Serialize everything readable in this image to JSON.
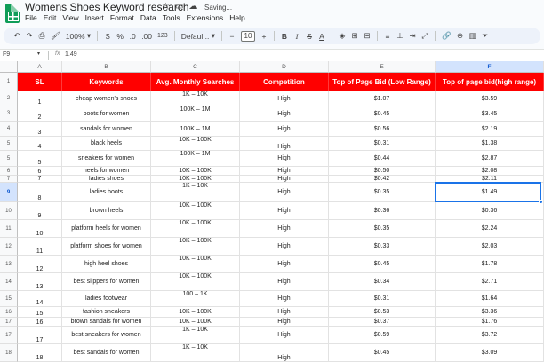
{
  "doc": {
    "title": "Womens Shoes Keyword research",
    "saving": "Saving...",
    "star_icon": "star-icon",
    "move_icon": "folder-icon",
    "cloud_icon": "cloud-sync-icon"
  },
  "menu": [
    "File",
    "Edit",
    "View",
    "Insert",
    "Format",
    "Data",
    "Tools",
    "Extensions",
    "Help"
  ],
  "toolbar": {
    "zoom": "100%",
    "currency": "$",
    "percent": "%",
    "dec_decrease": ".0",
    "dec_increase": ".00",
    "number_format": "123",
    "font": "Defaul...",
    "font_size": "10",
    "minus": "−",
    "plus": "+"
  },
  "formula_bar": {
    "name_box": "F9",
    "fx": "fx",
    "value": "1.49"
  },
  "columns": [
    "A",
    "B",
    "C",
    "D",
    "E",
    "F"
  ],
  "selected_column": "F",
  "selected_row": "9",
  "header_row": {
    "row_number": "1",
    "cells": [
      "SL",
      "Keywords",
      "Avg. Monthly Searches",
      "Competition",
      "Top of Page Bid (Low Range)",
      "Top of page bid(high range)"
    ]
  },
  "rows": [
    {
      "n": "2",
      "sl": "1",
      "kw": "cheap women's shoes",
      "avg": "1K – 10K",
      "comp": "High",
      "low": "$1.07",
      "high": "$3.59"
    },
    {
      "n": "3",
      "sl": "2",
      "kw": "boots for women",
      "avg": "100K – 1M",
      "comp": "High",
      "low": "$0.45",
      "high": "$3.45"
    },
    {
      "n": "4",
      "sl": "3",
      "kw": "sandals for women",
      "avg": "100K – 1M",
      "comp": "High",
      "low": "$0.56",
      "high": "$2.19"
    },
    {
      "n": "5",
      "sl": "4",
      "kw": "black heels",
      "avg": "10K – 100K",
      "comp": "High",
      "low": "$0.31",
      "high": "$1.38"
    },
    {
      "n": "5",
      "sl": "5",
      "kw": "sneakers for women",
      "avg": "100K – 1M",
      "comp": "High",
      "low": "$0.44",
      "high": "$2.87"
    },
    {
      "n": "6",
      "sl": "6",
      "kw": "heels for women",
      "avg": "10K – 100K",
      "comp": "High",
      "low": "$0.50",
      "high": "$2.08"
    },
    {
      "n": "7",
      "sl": "7",
      "kw": "ladies shoes",
      "avg": "10K – 100K",
      "comp": "High",
      "low": "$0.42",
      "high": "$2.11"
    },
    {
      "n": "9",
      "sl": "8",
      "kw": "ladies boots",
      "avg": "1K – 10K",
      "comp": "High",
      "low": "$0.35",
      "high": "$1.49"
    },
    {
      "n": "10",
      "sl": "9",
      "kw": "brown heels",
      "avg": "10K – 100K",
      "comp": "High",
      "low": "$0.36",
      "high": "$0.36"
    },
    {
      "n": "11",
      "sl": "10",
      "kw": "platform heels for women",
      "avg": "10K – 100K",
      "comp": "High",
      "low": "$0.35",
      "high": "$2.24"
    },
    {
      "n": "12",
      "sl": "11",
      "kw": "platform shoes for women",
      "avg": "10K – 100K",
      "comp": "High",
      "low": "$0.33",
      "high": "$2.03"
    },
    {
      "n": "13",
      "sl": "12",
      "kw": "high heel shoes",
      "avg": "10K – 100K",
      "comp": "High",
      "low": "$0.45",
      "high": "$1.78"
    },
    {
      "n": "14",
      "sl": "13",
      "kw": "best slippers for women",
      "avg": "10K – 100K",
      "comp": "High",
      "low": "$0.34",
      "high": "$2.71"
    },
    {
      "n": "15",
      "sl": "14",
      "kw": "ladies footwear",
      "avg": "100 – 1K",
      "comp": "High",
      "low": "$0.31",
      "high": "$1.64"
    },
    {
      "n": "16",
      "sl": "15",
      "kw": "fashion sneakers",
      "avg": "10K – 100K",
      "comp": "High",
      "low": "$0.53",
      "high": "$3.36"
    },
    {
      "n": "17",
      "sl": "16",
      "kw": "brown sandals for women",
      "avg": "10K – 100K",
      "comp": "High",
      "low": "$0.37",
      "high": "$1.76"
    },
    {
      "n": "17",
      "sl": "17",
      "kw": "best sneakers for women",
      "avg": "1K – 10K",
      "comp": "High",
      "low": "$0.59",
      "high": "$3.72"
    },
    {
      "n": "18",
      "sl": "18",
      "kw": "best sandals for women",
      "avg": "1K – 10K",
      "comp": "High",
      "low": "$0.45",
      "high": "$3.09"
    }
  ]
}
